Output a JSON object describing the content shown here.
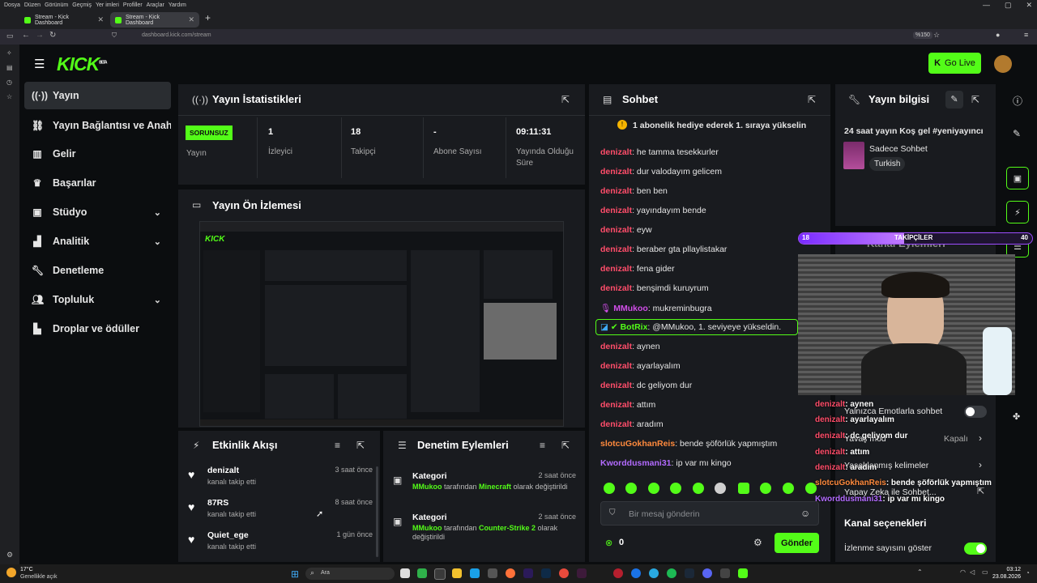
{
  "os_menu": [
    "Dosya",
    "Düzen",
    "Görünüm",
    "Geçmiş",
    "Yer imleri",
    "Profiller",
    "Araçlar",
    "Yardım"
  ],
  "tabs": [
    {
      "title": "Stream - Kick Dashboard"
    },
    {
      "title": "Stream - Kick Dashboard"
    }
  ],
  "address": {
    "url": "dashboard.kick.com/stream",
    "zoom": "%150"
  },
  "logo": {
    "text": "KICK",
    "beta": "BETA"
  },
  "header": {
    "go_live": "Go Live"
  },
  "sidebar": [
    {
      "label": "Yayın",
      "icon": "broadcast-icon"
    },
    {
      "label": "Yayın Bağlantısı ve Anahtarı",
      "icon": "link-icon"
    },
    {
      "label": "Gelir",
      "icon": "chart-icon"
    },
    {
      "label": "Başarılar",
      "icon": "trophy-icon"
    },
    {
      "label": "Stüdyo",
      "icon": "studio-icon"
    },
    {
      "label": "Analitik",
      "icon": "analytics-icon"
    },
    {
      "label": "Denetleme",
      "icon": "wrench-icon"
    },
    {
      "label": "Topluluk",
      "icon": "people-icon"
    },
    {
      "label": "Droplar ve ödüller",
      "icon": "gift-icon"
    }
  ],
  "stats": {
    "title": "Yayın İstatistikleri",
    "status_badge": "SORUNSUZ",
    "status_label": "Yayın",
    "items": [
      {
        "value": "1",
        "label": "İzleyici"
      },
      {
        "value": "18",
        "label": "Takipçi"
      },
      {
        "value": "-",
        "label": "Abone Sayısı"
      },
      {
        "value": "09:11:31",
        "label": "Yayında Olduğu Süre"
      }
    ]
  },
  "preview": {
    "title": "Yayın Ön İzlemesi"
  },
  "chat": {
    "title": "Sohbet",
    "pinned": "1 abonelik hediye ederek 1. sıraya yükselin",
    "messages": [
      {
        "user": "denizalt",
        "text": ": he tamma tesekkurler"
      },
      {
        "user": "denizalt",
        "text": ": dur valodayım gelicem"
      },
      {
        "user": "denizalt",
        "text": ": ben ben"
      },
      {
        "user": "denizalt",
        "text": ": yayındayım bende"
      },
      {
        "user": "denizalt",
        "text": ": eyw"
      },
      {
        "user": "denizalt",
        "text": ": beraber gta pllaylistakar"
      },
      {
        "user": "denizalt",
        "text": ": fena gider"
      },
      {
        "user": "denizalt",
        "text": ": benşimdi kuruyrum"
      },
      {
        "user": "MMukoo",
        "text": ": mukreminbugra"
      },
      {
        "user": "BotRix",
        "text": ": @MMukoo, 1. seviyeye yükseldin."
      },
      {
        "user": "denizalt",
        "text": ": aynen"
      },
      {
        "user": "denizalt",
        "text": ": ayarlayalım"
      },
      {
        "user": "denizalt",
        "text": ": dc geliyom dur"
      },
      {
        "user": "denizalt",
        "text": ": attım"
      },
      {
        "user": "denizalt",
        "text": ": aradım"
      },
      {
        "user": "slotcuGokhanReis",
        "text": ": bende şöförlük yapmıştım"
      },
      {
        "user": "Kworddusmani31",
        "text": ": ip var mı kingo"
      }
    ],
    "input_placeholder": "Bir mesaj gönderin",
    "points": "0",
    "send": "Gönder"
  },
  "info": {
    "title": "Yayın bilgisi",
    "stream_title": "24 saat yayın Koş gel #yeniyayıncı",
    "category": "Sadece Sohbet",
    "language": "Turkish"
  },
  "activity": {
    "title": "Etkinlik Akışı",
    "items": [
      {
        "name": "denizalt",
        "sub": "kanalı takip etti",
        "time": "3 saat önce"
      },
      {
        "name": "87RS",
        "sub": "kanalı takip etti",
        "time": "8 saat önce"
      },
      {
        "name": "Quiet_ege",
        "sub": "kanalı takip etti",
        "time": "1 gün önce"
      }
    ]
  },
  "moderation": {
    "title": "Denetim Eylemleri",
    "items": [
      {
        "name": "Kategori",
        "time": "2 saat önce",
        "actor": "MMukoo",
        "mid": " tarafından ",
        "target": "Minecraft",
        "end": " olarak değiştirildi"
      },
      {
        "name": "Kategori",
        "time": "2 saat önce",
        "actor": "MMukoo",
        "mid": " tarafından ",
        "target": "Counter-Strike 2",
        "end": " olarak değiştirildi"
      }
    ]
  },
  "chat_settings": {
    "emote_only": "Yalnızca Emotlarla sohbet",
    "slow_mode": "Yavaş mod",
    "slow_mode_value": "Kapalı",
    "banned_words": "Yasaklanmış kelimeler",
    "ai_chat": "Yapay Zeka ile Sohbet...",
    "channel_options": "Kanal seçenekleri",
    "show_viewers": "İzlenme sayısını göster"
  },
  "overlay": {
    "followers_label": "TAKİPÇİLER",
    "followers_now": "18",
    "followers_goal": "40",
    "followers_progress": 0.45,
    "hidden_title": "Kanal Eylemleri",
    "chat": [
      {
        "user": "denizalt",
        "text": ": aynen"
      },
      {
        "user": "denizalt",
        "text": ": ayarlayalım"
      },
      {
        "user": "denizalt",
        "text": ": dc geliyom dur"
      },
      {
        "user": "denizalt",
        "text": ": attım"
      },
      {
        "user": "denizalt",
        "text": ": aradım"
      },
      {
        "user": "slotcuGokhanReis",
        "text": ": bende şöförlük yapmıştım"
      },
      {
        "user": "Kworddusmani31",
        "text": ": ip var mı kingo"
      }
    ]
  },
  "taskbar": {
    "weather_temp": "17°C",
    "weather_desc": "Genellikle açık",
    "search": "Ara",
    "time": "03:12",
    "date": "23.08.2026"
  }
}
